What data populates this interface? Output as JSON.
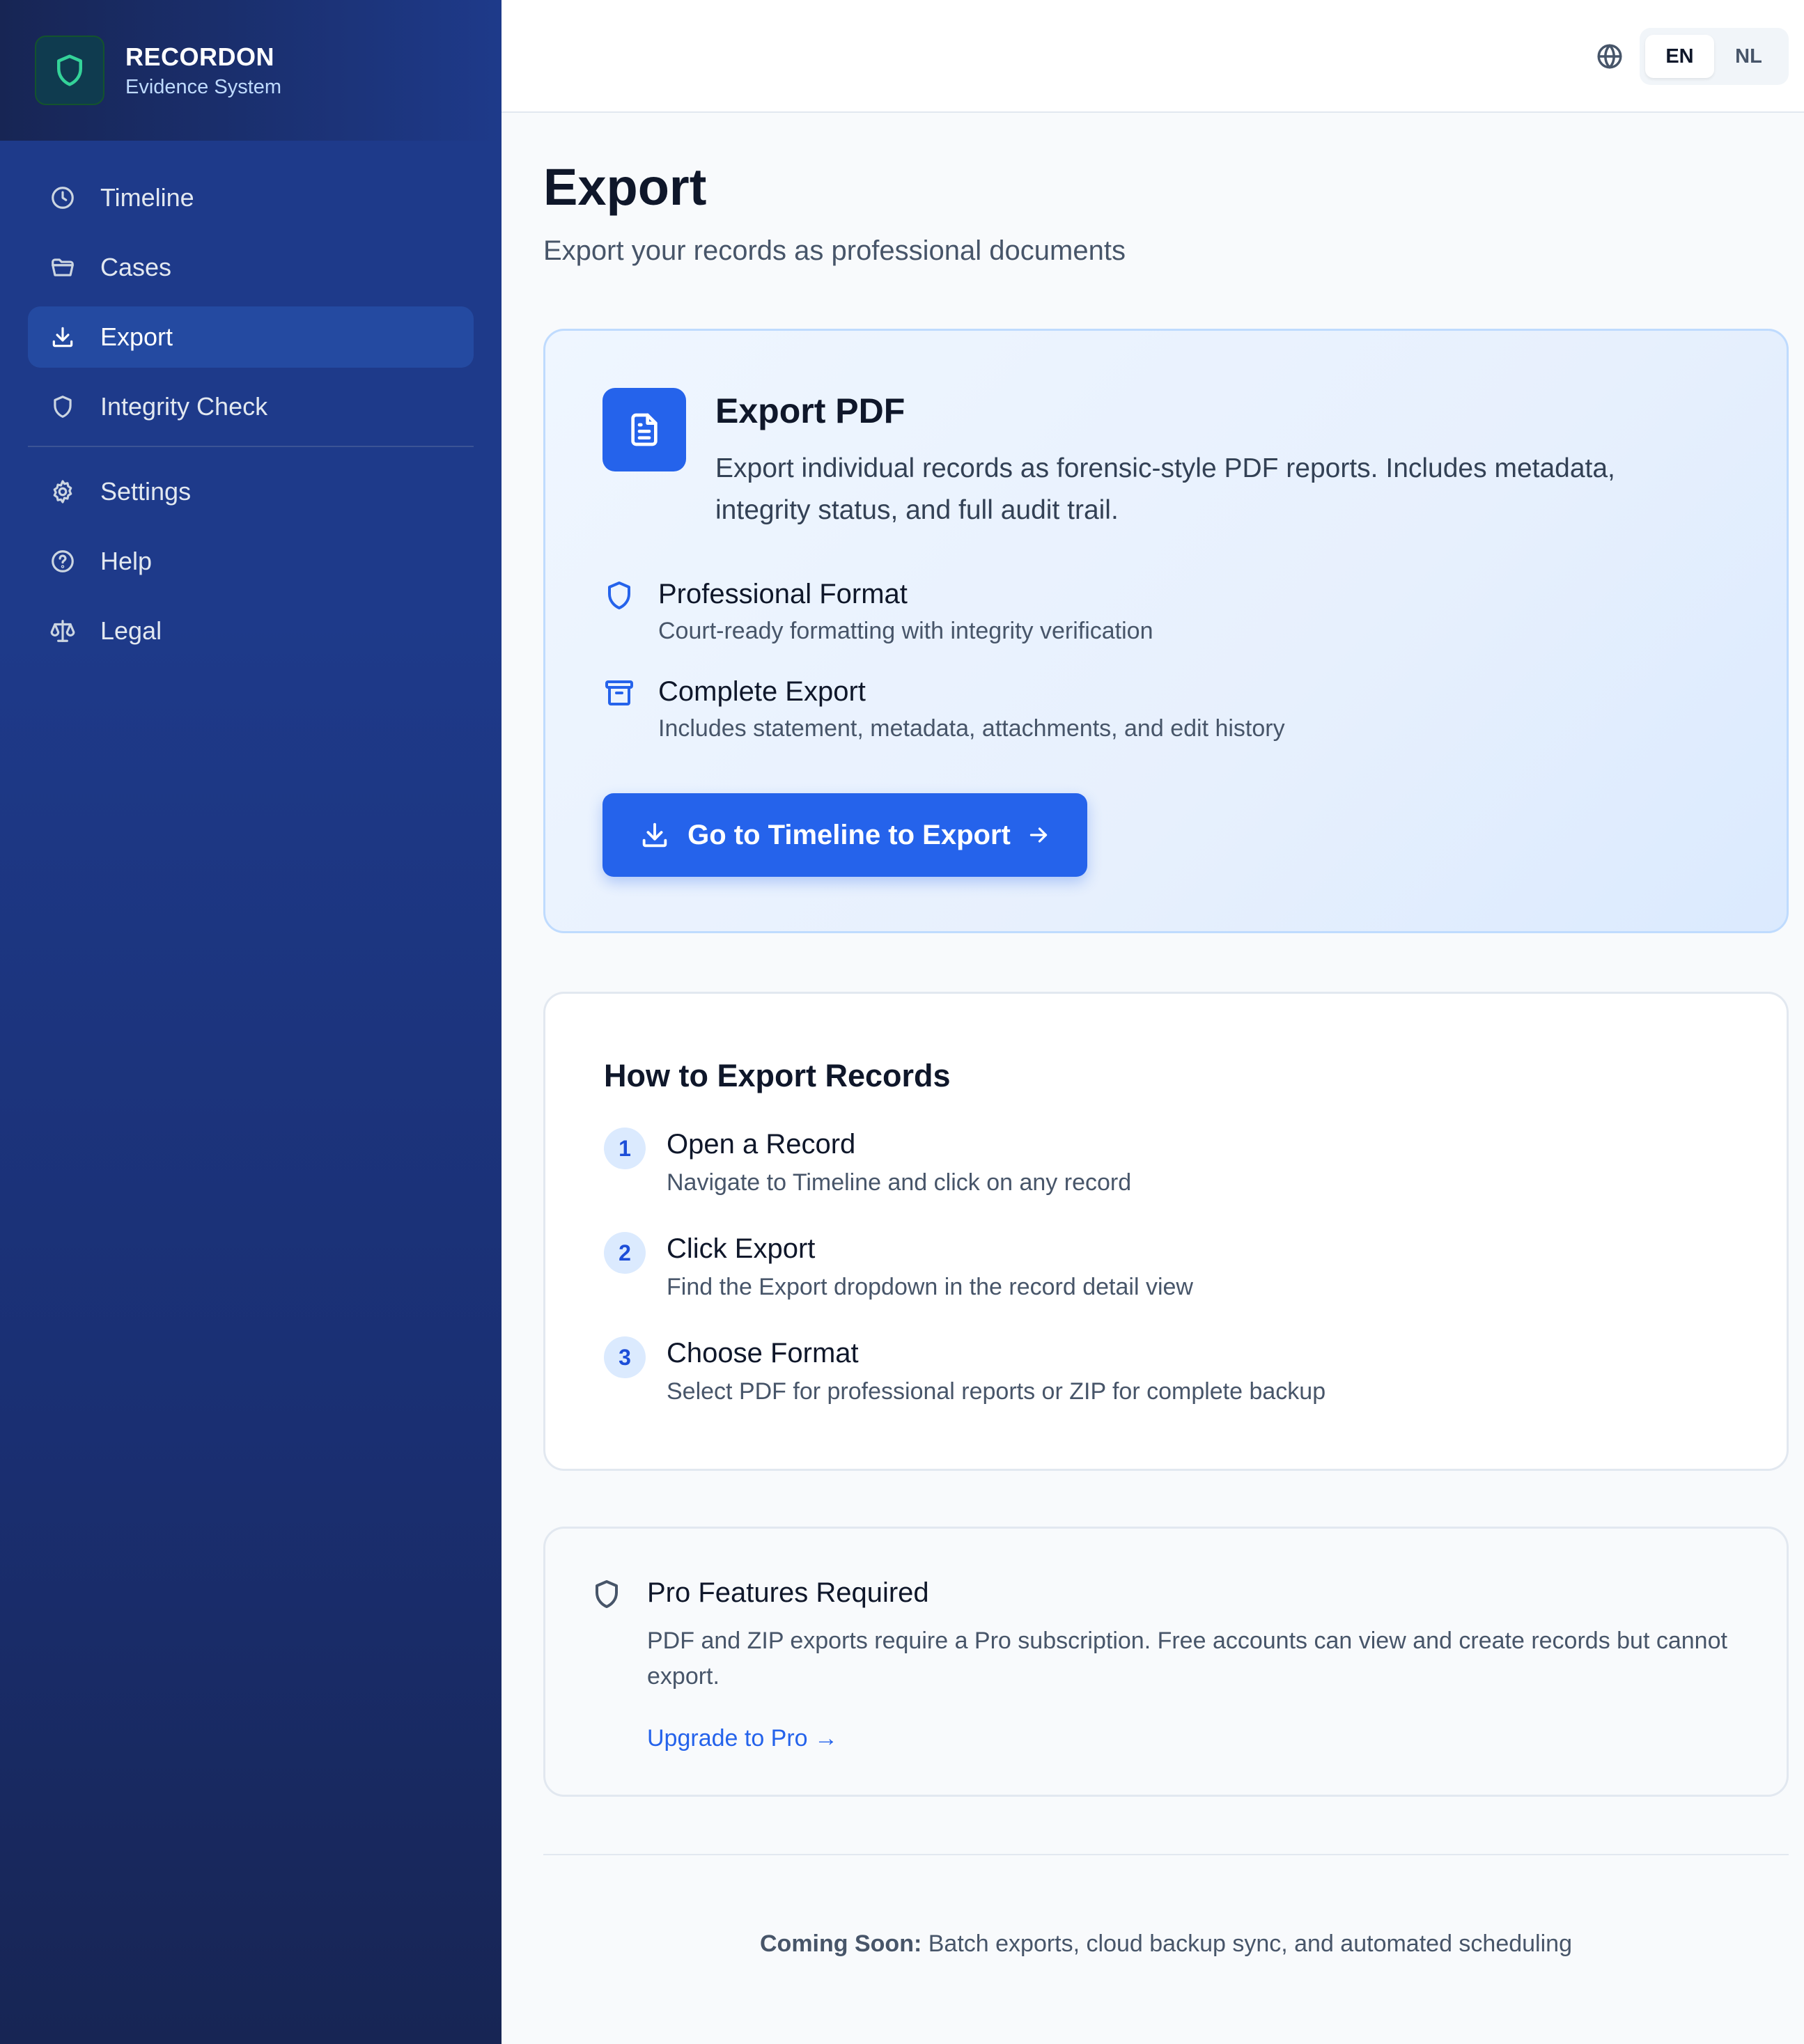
{
  "brand": {
    "name": "RECORDON",
    "subtitle": "Evidence System"
  },
  "sidebar": {
    "items": [
      {
        "label": "Timeline",
        "icon": "clock-icon"
      },
      {
        "label": "Cases",
        "icon": "folder-icon"
      },
      {
        "label": "Export",
        "icon": "download-icon",
        "active": true
      },
      {
        "label": "Integrity Check",
        "icon": "shield-icon"
      },
      {
        "label": "Settings",
        "icon": "gear-icon"
      },
      {
        "label": "Help",
        "icon": "help-circle-icon"
      },
      {
        "label": "Legal",
        "icon": "scale-icon"
      }
    ]
  },
  "topbar": {
    "languages": [
      "EN",
      "NL"
    ],
    "active_language": "EN"
  },
  "page": {
    "title": "Export",
    "subtitle": "Export your records as professional documents"
  },
  "pdf_card": {
    "title": "Export PDF",
    "description": "Export individual records as forensic-style PDF reports. Includes metadata, integrity status, and full audit trail.",
    "features": [
      {
        "title": "Professional Format",
        "desc": "Court-ready formatting with integrity verification"
      },
      {
        "title": "Complete Export",
        "desc": "Includes statement, metadata, attachments, and edit history"
      }
    ],
    "cta_label": "Go to Timeline to Export"
  },
  "how_card": {
    "title": "How to Export Records",
    "steps": [
      {
        "num": "1",
        "title": "Open a Record",
        "desc": "Navigate to Timeline and click on any record"
      },
      {
        "num": "2",
        "title": "Click Export",
        "desc": "Find the Export dropdown in the record detail view"
      },
      {
        "num": "3",
        "title": "Choose Format",
        "desc": "Select PDF for professional reports or ZIP for complete backup"
      }
    ]
  },
  "pro_card": {
    "title": "Pro Features Required",
    "description": "PDF and ZIP exports require a Pro subscription. Free accounts can view and create records but cannot export.",
    "link_label": "Upgrade to Pro →"
  },
  "footer": {
    "coming_label": "Coming Soon:",
    "coming_text": " Batch exports, cloud backup sync, and automated scheduling"
  },
  "colors": {
    "accent": "#2563eb",
    "sidebar": "#1e3a8a",
    "logo_accent": "#34d399"
  }
}
